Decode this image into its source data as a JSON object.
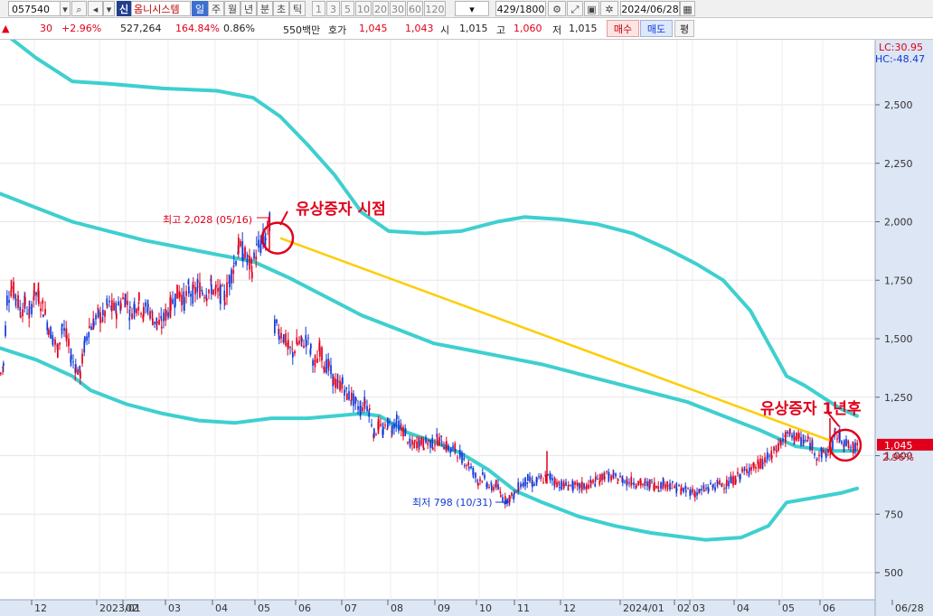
{
  "toolbar": {
    "code": "057540",
    "tag": "신",
    "name": "옴니시스템",
    "periods": [
      "일",
      "주",
      "월",
      "년",
      "분",
      "초",
      "틱"
    ],
    "selected_period": "일",
    "intervals": [
      "1",
      "3",
      "5",
      "10",
      "20",
      "30",
      "60",
      "120"
    ],
    "count": "429",
    "count_total": "/1800",
    "date": "2024/06/28",
    "icons": [
      "dropdown-arrow-icon",
      "search-icon",
      "speaker-icon",
      "chevron-down-icon",
      "settings-tools-icon",
      "link-icon",
      "save-icon",
      "gear-icon",
      "calendar-icon"
    ]
  },
  "infobar": {
    "change": "30",
    "change_pct": "+2.96%",
    "volume": "527,264",
    "volume_ratio": "164.84%",
    "turnover": "0.86%",
    "amount": "550백만",
    "ask_label": "호가",
    "ask1": "1,045",
    "ask2": "1,043",
    "open_label": "시",
    "open": "1,015",
    "high_label": "고",
    "high": "1,060",
    "low_label": "저",
    "low": "1,015",
    "buy_label": "매수",
    "sell_label": "매도",
    "flat_label": "평"
  },
  "colors": {
    "up": "#e0001b",
    "down": "#1038d8",
    "band": "#3fcfcf",
    "trend": "#ffcc00",
    "annotation": "#e0001b",
    "axis_bg": "#dce6f4"
  },
  "chart_data": {
    "type": "candlestick",
    "y_ticks": [
      "2,500",
      "2,250",
      "2,000",
      "1,750",
      "1,500",
      "1,250",
      "1,000",
      "750",
      "500"
    ],
    "y_values": [
      2500,
      2250,
      2000,
      1750,
      1500,
      1250,
      1000,
      750,
      500
    ],
    "x_ticks": [
      "12",
      "2023/01",
      "02",
      "03",
      "04",
      "05",
      "06",
      "07",
      "08",
      "09",
      "10",
      "11",
      "12",
      "2024/01",
      "02",
      "03",
      "04",
      "05",
      "06",
      "06/28"
    ],
    "lc": "LC:30.95",
    "hc": "HC:-48.47",
    "current_price": "1,045",
    "current_change": "2.96%",
    "max_label": "최고 2,028 (05/16)",
    "min_label": "최저 798 (10/31)",
    "annotation_1": "유상증자 시점",
    "annotation_2": "유상증자 1년후",
    "price_path": [
      [
        0,
        1350
      ],
      [
        3,
        1390
      ],
      [
        7,
        1670
      ],
      [
        12,
        1720
      ],
      [
        17,
        1680
      ],
      [
        22,
        1620
      ],
      [
        27,
        1650
      ],
      [
        32,
        1600
      ],
      [
        37,
        1700
      ],
      [
        42,
        1680
      ],
      [
        47,
        1630
      ],
      [
        53,
        1550
      ],
      [
        58,
        1500
      ],
      [
        63,
        1450
      ],
      [
        68,
        1560
      ],
      [
        73,
        1500
      ],
      [
        78,
        1420
      ],
      [
        83,
        1380
      ],
      [
        88,
        1350
      ],
      [
        93,
        1480
      ],
      [
        98,
        1550
      ],
      [
        103,
        1570
      ],
      [
        108,
        1600
      ],
      [
        113,
        1590
      ],
      [
        118,
        1640
      ],
      [
        123,
        1630
      ],
      [
        128,
        1620
      ],
      [
        133,
        1650
      ],
      [
        138,
        1680
      ],
      [
        143,
        1610
      ],
      [
        148,
        1640
      ],
      [
        153,
        1660
      ],
      [
        158,
        1610
      ],
      [
        163,
        1640
      ],
      [
        168,
        1590
      ],
      [
        173,
        1570
      ],
      [
        178,
        1560
      ],
      [
        183,
        1610
      ],
      [
        188,
        1640
      ],
      [
        193,
        1680
      ],
      [
        198,
        1700
      ],
      [
        203,
        1660
      ],
      [
        208,
        1710
      ],
      [
        213,
        1690
      ],
      [
        218,
        1720
      ],
      [
        223,
        1710
      ],
      [
        228,
        1700
      ],
      [
        233,
        1720
      ],
      [
        238,
        1700
      ],
      [
        243,
        1690
      ],
      [
        248,
        1680
      ],
      [
        253,
        1750
      ],
      [
        258,
        1820
      ],
      [
        263,
        1890
      ],
      [
        268,
        1870
      ],
      [
        273,
        1830
      ],
      [
        278,
        1800
      ],
      [
        283,
        1880
      ],
      [
        288,
        1900
      ],
      [
        293,
        1930
      ],
      [
        298,
        2000
      ],
      [
        303,
        1560
      ],
      [
        308,
        1530
      ],
      [
        313,
        1510
      ],
      [
        318,
        1460
      ],
      [
        323,
        1440
      ],
      [
        328,
        1480
      ],
      [
        333,
        1480
      ],
      [
        338,
        1500
      ],
      [
        343,
        1450
      ],
      [
        348,
        1380
      ],
      [
        353,
        1460
      ],
      [
        358,
        1390
      ],
      [
        363,
        1380
      ],
      [
        368,
        1320
      ],
      [
        373,
        1300
      ],
      [
        378,
        1310
      ],
      [
        383,
        1260
      ],
      [
        388,
        1250
      ],
      [
        393,
        1220
      ],
      [
        398,
        1200
      ],
      [
        403,
        1230
      ],
      [
        408,
        1190
      ],
      [
        413,
        1090
      ],
      [
        418,
        1130
      ],
      [
        423,
        1100
      ],
      [
        428,
        1140
      ],
      [
        433,
        1120
      ],
      [
        438,
        1150
      ],
      [
        443,
        1110
      ],
      [
        448,
        1100
      ],
      [
        453,
        1040
      ],
      [
        458,
        1050
      ],
      [
        463,
        1060
      ],
      [
        468,
        1050
      ],
      [
        473,
        1060
      ],
      [
        478,
        1050
      ],
      [
        483,
        1070
      ],
      [
        488,
        1060
      ],
      [
        493,
        1040
      ],
      [
        498,
        1020
      ],
      [
        503,
        1030
      ],
      [
        508,
        1000
      ],
      [
        513,
        980
      ],
      [
        518,
        960
      ],
      [
        523,
        930
      ],
      [
        528,
        890
      ],
      [
        533,
        910
      ],
      [
        538,
        880
      ],
      [
        543,
        860
      ],
      [
        548,
        880
      ],
      [
        553,
        830
      ],
      [
        558,
        810
      ],
      [
        563,
        820
      ],
      [
        568,
        830
      ],
      [
        573,
        870
      ],
      [
        578,
        880
      ],
      [
        583,
        900
      ],
      [
        588,
        880
      ],
      [
        593,
        890
      ],
      [
        598,
        900
      ],
      [
        603,
        905
      ],
      [
        608,
        910
      ],
      [
        613,
        890
      ],
      [
        618,
        880
      ],
      [
        623,
        870
      ],
      [
        628,
        875
      ],
      [
        633,
        870
      ],
      [
        638,
        865
      ],
      [
        643,
        870
      ],
      [
        648,
        870
      ],
      [
        653,
        880
      ],
      [
        658,
        890
      ],
      [
        663,
        900
      ],
      [
        668,
        920
      ],
      [
        673,
        910
      ],
      [
        678,
        905
      ],
      [
        683,
        900
      ],
      [
        688,
        900
      ],
      [
        693,
        890
      ],
      [
        698,
        890
      ],
      [
        703,
        885
      ],
      [
        708,
        880
      ],
      [
        713,
        875
      ],
      [
        718,
        880
      ],
      [
        723,
        875
      ],
      [
        728,
        870
      ],
      [
        733,
        880
      ],
      [
        738,
        880
      ],
      [
        743,
        870
      ],
      [
        748,
        860
      ],
      [
        753,
        855
      ],
      [
        758,
        850
      ],
      [
        763,
        850
      ],
      [
        768,
        840
      ],
      [
        773,
        845
      ],
      [
        778,
        855
      ],
      [
        783,
        860
      ],
      [
        788,
        870
      ],
      [
        793,
        875
      ],
      [
        798,
        880
      ],
      [
        803,
        880
      ],
      [
        808,
        890
      ],
      [
        813,
        900
      ],
      [
        818,
        920
      ],
      [
        823,
        930
      ],
      [
        828,
        950
      ],
      [
        833,
        950
      ],
      [
        838,
        960
      ],
      [
        843,
        970
      ],
      [
        848,
        990
      ],
      [
        853,
        1000
      ],
      [
        858,
        1030
      ],
      [
        863,
        1060
      ],
      [
        868,
        1080
      ],
      [
        873,
        1090
      ],
      [
        878,
        1085
      ],
      [
        883,
        1070
      ],
      [
        888,
        1065
      ],
      [
        893,
        1060
      ],
      [
        898,
        1040
      ],
      [
        903,
        1000
      ],
      [
        908,
        1010
      ],
      [
        913,
        1010
      ],
      [
        918,
        1020
      ],
      [
        923,
        1090
      ],
      [
        928,
        1080
      ],
      [
        933,
        1060
      ],
      [
        938,
        1040
      ],
      [
        943,
        1030
      ],
      [
        948,
        1045
      ]
    ],
    "upper_band": [
      [
        0,
        2820
      ],
      [
        40,
        2700
      ],
      [
        80,
        2600
      ],
      [
        120,
        2590
      ],
      [
        180,
        2570
      ],
      [
        240,
        2560
      ],
      [
        280,
        2530
      ],
      [
        310,
        2450
      ],
      [
        340,
        2330
      ],
      [
        370,
        2200
      ],
      [
        400,
        2040
      ],
      [
        430,
        1960
      ],
      [
        470,
        1950
      ],
      [
        510,
        1960
      ],
      [
        550,
        2000
      ],
      [
        580,
        2020
      ],
      [
        620,
        2010
      ],
      [
        660,
        1990
      ],
      [
        700,
        1950
      ],
      [
        740,
        1880
      ],
      [
        770,
        1820
      ],
      [
        800,
        1750
      ],
      [
        830,
        1620
      ],
      [
        850,
        1480
      ],
      [
        870,
        1340
      ],
      [
        890,
        1300
      ],
      [
        910,
        1250
      ],
      [
        930,
        1200
      ],
      [
        948,
        1170
      ]
    ],
    "middle_band": [
      [
        0,
        2120
      ],
      [
        40,
        2060
      ],
      [
        80,
        2000
      ],
      [
        120,
        1960
      ],
      [
        160,
        1920
      ],
      [
        200,
        1890
      ],
      [
        240,
        1860
      ],
      [
        280,
        1830
      ],
      [
        320,
        1760
      ],
      [
        360,
        1680
      ],
      [
        400,
        1600
      ],
      [
        440,
        1540
      ],
      [
        480,
        1480
      ],
      [
        520,
        1450
      ],
      [
        560,
        1420
      ],
      [
        600,
        1390
      ],
      [
        640,
        1350
      ],
      [
        680,
        1310
      ],
      [
        720,
        1270
      ],
      [
        760,
        1230
      ],
      [
        800,
        1170
      ],
      [
        840,
        1110
      ],
      [
        880,
        1040
      ],
      [
        920,
        1020
      ],
      [
        948,
        1020
      ]
    ],
    "lower_band": [
      [
        0,
        1460
      ],
      [
        40,
        1410
      ],
      [
        80,
        1340
      ],
      [
        100,
        1280
      ],
      [
        140,
        1220
      ],
      [
        180,
        1180
      ],
      [
        220,
        1150
      ],
      [
        260,
        1140
      ],
      [
        300,
        1160
      ],
      [
        340,
        1160
      ],
      [
        370,
        1170
      ],
      [
        400,
        1180
      ],
      [
        420,
        1170
      ],
      [
        450,
        1100
      ],
      [
        480,
        1060
      ],
      [
        510,
        1010
      ],
      [
        540,
        940
      ],
      [
        570,
        850
      ],
      [
        600,
        800
      ],
      [
        640,
        740
      ],
      [
        680,
        700
      ],
      [
        720,
        670
      ],
      [
        760,
        650
      ],
      [
        780,
        640
      ],
      [
        820,
        650
      ],
      [
        850,
        700
      ],
      [
        870,
        800
      ],
      [
        900,
        820
      ],
      [
        930,
        840
      ],
      [
        948,
        860
      ]
    ],
    "trendline": [
      [
        310,
        1930
      ],
      [
        918,
        1065
      ]
    ],
    "circles": [
      [
        307,
        1930
      ],
      [
        935,
        1045
      ]
    ]
  }
}
